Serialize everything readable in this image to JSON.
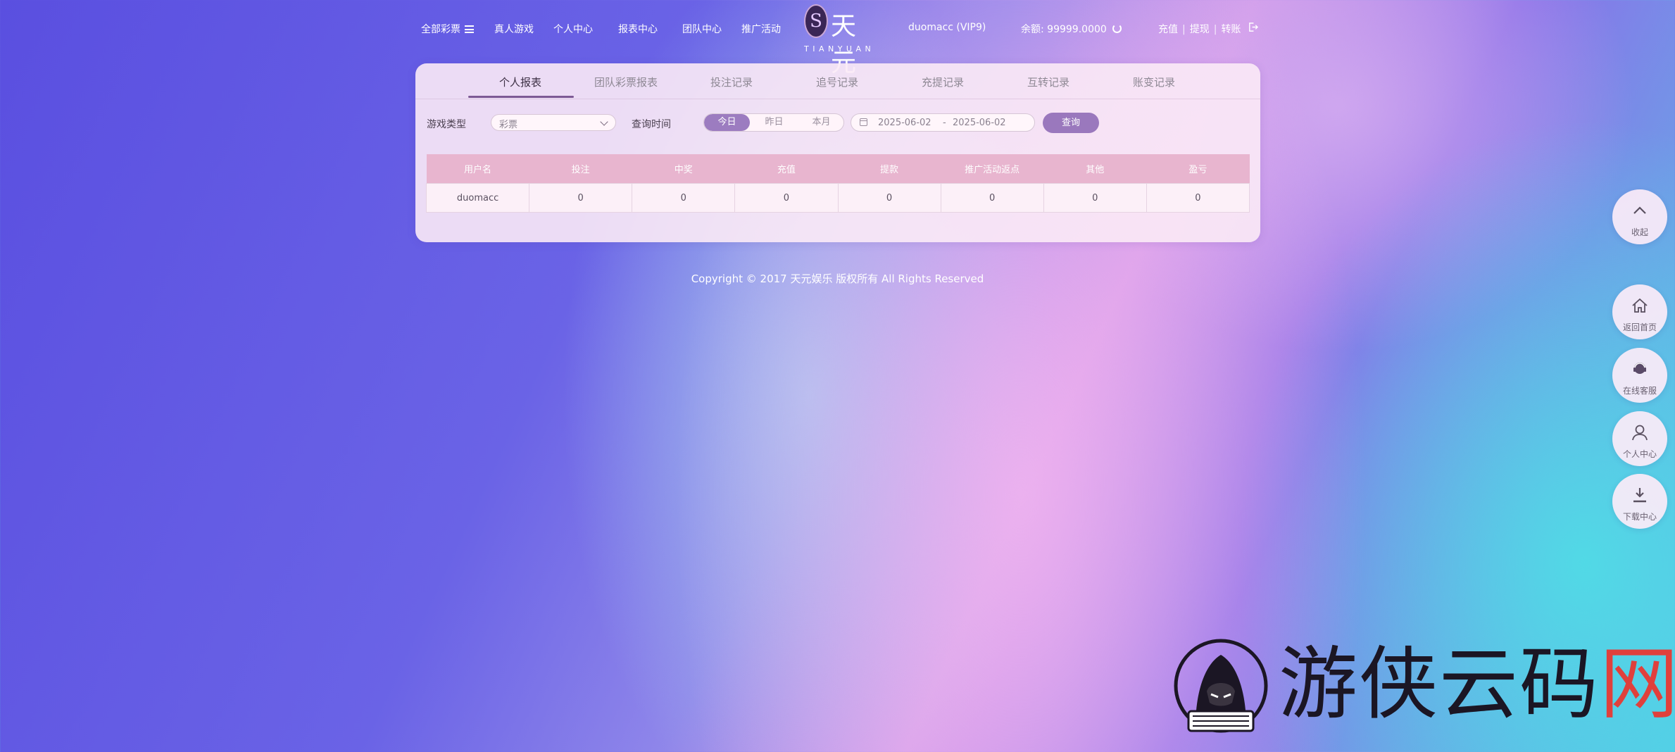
{
  "header": {
    "nav": {
      "all_lottery": "全部彩票",
      "live_games": "真人游戏",
      "personal_center": "个人中心",
      "report_center": "报表中心",
      "team_center": "团队中心",
      "promotions": "推广活动"
    },
    "logo": {
      "cn": "天元",
      "en": "TIANYUAN"
    },
    "username": "duomacc (VIP9)",
    "balance_label": "余额:",
    "balance_value": "99999.0000",
    "links": {
      "recharge": "充值",
      "withdraw": "提现",
      "transfer": "转账",
      "separator": "|"
    }
  },
  "tabs": [
    {
      "label": "个人报表",
      "active": true
    },
    {
      "label": "团队彩票报表"
    },
    {
      "label": "投注记录"
    },
    {
      "label": "追号记录"
    },
    {
      "label": "充提记录"
    },
    {
      "label": "互转记录"
    },
    {
      "label": "账变记录"
    }
  ],
  "filters": {
    "game_type_label": "游戏类型",
    "game_type_value": "彩票",
    "query_time_label": "查询时间",
    "ranges": [
      "今日",
      "昨日",
      "本月"
    ],
    "active_range": "今日",
    "date_from": "2025-06-02",
    "date_separator": "-",
    "date_to": "2025-06-02",
    "query_button": "查询"
  },
  "table": {
    "headers": [
      "用户名",
      "投注",
      "中奖",
      "充值",
      "提款",
      "推广活动返点",
      "其他",
      "盈亏"
    ],
    "rows": [
      [
        "duomacc",
        "0",
        "0",
        "0",
        "0",
        "0",
        "0",
        "0"
      ]
    ]
  },
  "copyright": "Copyright © 2017 天元娱乐 版权所有 All Rights Reserved",
  "side": {
    "collapse": "收起",
    "home": "返回首页",
    "service": "在线客服",
    "personal": "个人中心",
    "download": "下载中心"
  },
  "watermark": {
    "text": "游侠云码",
    "last_char": "网"
  },
  "colors": {
    "accent": "#9a78bd",
    "table_header": "#e8b5cf",
    "watermark_red": "#e0403c"
  }
}
